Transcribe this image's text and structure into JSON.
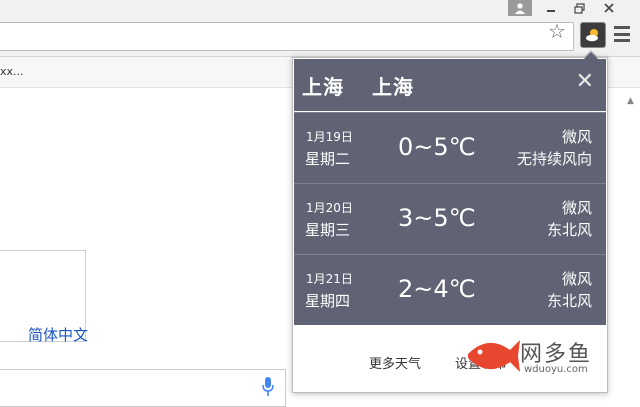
{
  "bookmarks": {
    "item": "xx..."
  },
  "page": {
    "language_link": "简体中文"
  },
  "popup": {
    "city_primary": "上海",
    "city_secondary": "上海",
    "close_symbol": "✕",
    "days": [
      {
        "date": "1月19日",
        "weekday": "星期二",
        "temp": "0~5℃",
        "wind": "微风",
        "direction": "无持续风向"
      },
      {
        "date": "1月20日",
        "weekday": "星期三",
        "temp": "3~5℃",
        "wind": "微风",
        "direction": "东北风"
      },
      {
        "date": "1月21日",
        "weekday": "星期四",
        "temp": "2~4℃",
        "wind": "微风",
        "direction": "东北风"
      }
    ],
    "more_weather": "更多天气",
    "settings": "设置城市"
  },
  "watermark": {
    "name": "网多鱼",
    "url": "wduoyu.com"
  },
  "colors": {
    "panel": "#5f6373",
    "accent_watermark": "#e8472f",
    "link": "#1a55c0"
  }
}
